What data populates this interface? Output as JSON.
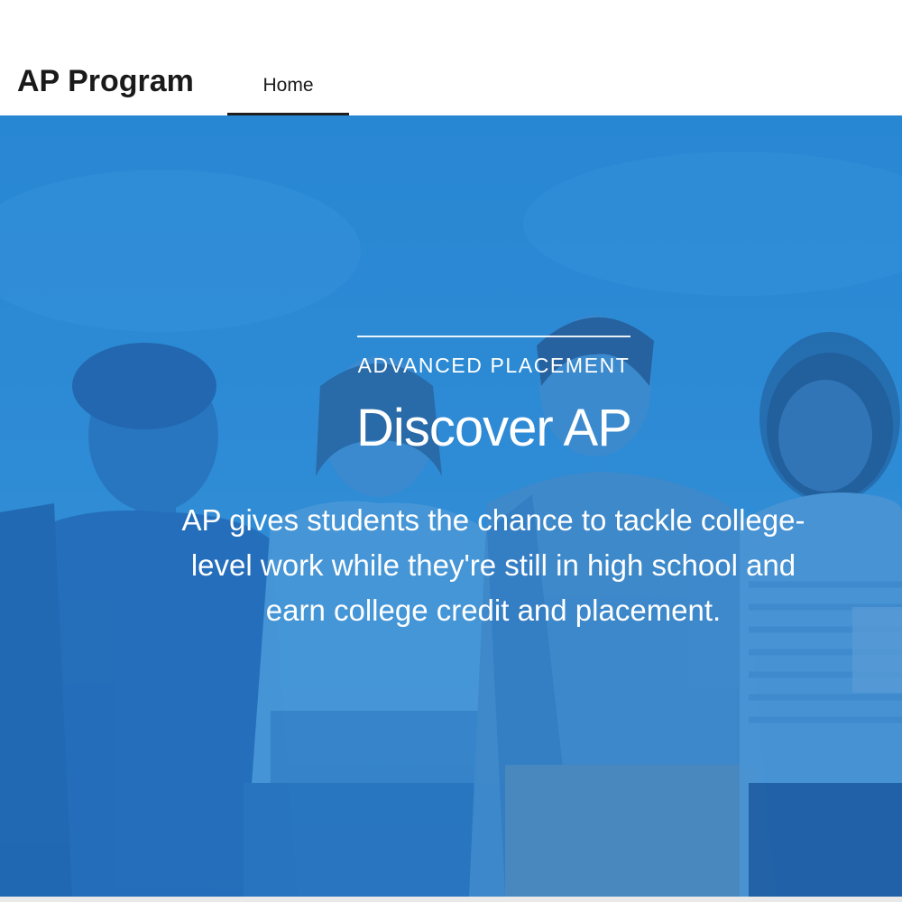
{
  "header": {
    "site_title": "AP Program",
    "nav": {
      "tabs": [
        {
          "label": "Home",
          "active": true
        }
      ]
    }
  },
  "hero": {
    "eyebrow": "ADVANCED PLACEMENT",
    "heading": "Discover AP",
    "description": "AP gives students the chance to tackle college-level work while they're still in high school and earn college credit and placement.",
    "image_subject": "group-of-students-photo",
    "overlay_color": "#2f8cd6"
  },
  "colors": {
    "accent": "#2f8cd6",
    "header_text": "#1a1a1a",
    "hero_text": "#ffffff"
  }
}
